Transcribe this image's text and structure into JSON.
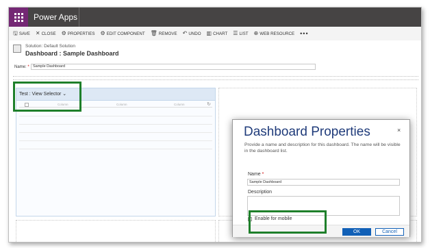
{
  "app": {
    "name": "Power Apps"
  },
  "toolbar": {
    "save": "SAVE",
    "close": "CLOSE",
    "properties": "PROPERTIES",
    "edit_component": "EDIT COMPONENT",
    "remove": "REMOVE",
    "undo": "UNDO",
    "chart": "CHART",
    "list": "LIST",
    "web_resource": "WEB RESOURCE",
    "more": "•••"
  },
  "header": {
    "solution": "Solution: Default Solution",
    "title": "Dashboard : Sample Dashboard"
  },
  "name_field": {
    "label": "Name:",
    "required": "*",
    "value": "Sample Dashboard"
  },
  "designer": {
    "view_selector": "Test : View Selector ⌄",
    "columns": [
      "Column",
      "Column",
      "Column"
    ]
  },
  "dialog": {
    "title": "Dashboard Properties",
    "close": "×",
    "description": "Provide a name and description for this dashboard. The name will be visible in the dashboard list.",
    "name_label": "Name",
    "name_required": "*",
    "name_value": "Sample Dashboard",
    "description_label": "Description",
    "description_value": "",
    "mobile_label": "Enable for mobile",
    "mobile_checked": false,
    "ok": "OK",
    "cancel": "Cancel"
  },
  "colors": {
    "topbar": "#464444",
    "waffle": "#742774",
    "dialog_title": "#1f3b7a",
    "primary_button": "#1160b7",
    "highlight": "#1e7f2a"
  }
}
